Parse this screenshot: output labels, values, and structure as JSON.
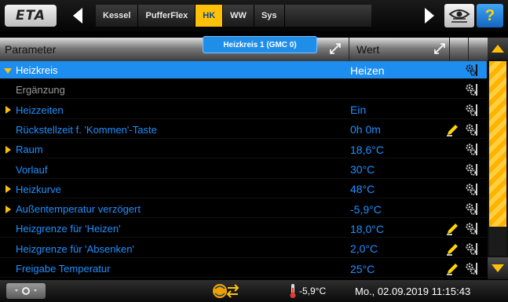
{
  "topbar": {
    "logo_text": "ETA",
    "tabs": [
      {
        "label": "Kessel",
        "active": false
      },
      {
        "label": "PufferFlex",
        "active": false
      },
      {
        "label": "HK",
        "active": true
      },
      {
        "label": "WW",
        "active": false
      },
      {
        "label": "Sys",
        "active": false
      }
    ],
    "help_label": "?",
    "tooltip": "Heizkreis 1 (GMC 0)",
    "icons": {
      "back": "chevron-left-icon",
      "forward": "chevron-right-icon",
      "view": "eye-icon"
    }
  },
  "table": {
    "col_parameter": "Parameter",
    "col_wert": "Wert",
    "rows": [
      {
        "name": "Heizkreis",
        "value": "Heizen",
        "selected": true,
        "expandable": true,
        "gray": false,
        "editable": false
      },
      {
        "name": "Ergänzung",
        "value": "",
        "selected": false,
        "expandable": false,
        "gray": true,
        "editable": false
      },
      {
        "name": "Heizzeiten",
        "value": "Ein",
        "selected": false,
        "expandable": true,
        "gray": false,
        "editable": false
      },
      {
        "name": "Rückstellzeit f. 'Kommen'-Taste",
        "value": "0h 0m",
        "selected": false,
        "expandable": false,
        "gray": false,
        "editable": true
      },
      {
        "name": "Raum",
        "value": "18,6°C",
        "selected": false,
        "expandable": true,
        "gray": false,
        "editable": false
      },
      {
        "name": "Vorlauf",
        "value": "30°C",
        "selected": false,
        "expandable": false,
        "gray": false,
        "editable": false
      },
      {
        "name": "Heizkurve",
        "value": "48°C",
        "selected": false,
        "expandable": true,
        "gray": false,
        "editable": false
      },
      {
        "name": "Außentemperatur verzögert",
        "value": "-5,9°C",
        "selected": false,
        "expandable": true,
        "gray": false,
        "editable": false
      },
      {
        "name": "Heizgrenze für 'Heizen'",
        "value": "18,0°C",
        "selected": false,
        "expandable": false,
        "gray": false,
        "editable": true
      },
      {
        "name": "Heizgrenze für 'Absenken'",
        "value": "2,0°C",
        "selected": false,
        "expandable": false,
        "gray": false,
        "editable": true
      },
      {
        "name": "Freigabe Temperatur",
        "value": "25°C",
        "selected": false,
        "expandable": false,
        "gray": false,
        "editable": true
      }
    ]
  },
  "scrollbar": {
    "position_fraction": 0.0,
    "visible_fraction": 0.85
  },
  "status": {
    "outdoor_temp": "-5,9°C",
    "datetime": "Mo., 02.09.2019 11:15:43",
    "tools_icon": "tools-icon",
    "network_icon": "network-sync-icon",
    "thermometer_icon": "thermometer-icon"
  },
  "colors": {
    "accent_blue": "#1e90ff",
    "selection": "#1e8df0",
    "tab_active": "#ffc107",
    "pen_yellow": "#ffd600"
  }
}
